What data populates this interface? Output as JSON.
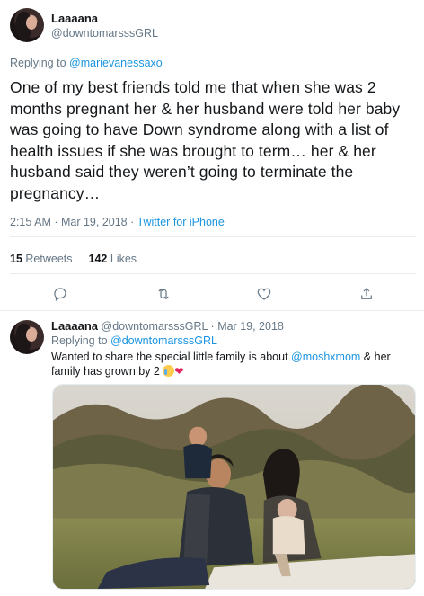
{
  "main_tweet": {
    "author_name": "Laaaana",
    "author_handle": "@downtomarsssGRL",
    "replying_prefix": "Replying to",
    "replying_to": "@marievanessaxo",
    "text": "One of my best friends told me that when she was 2 months pregnant her & her husband were told her baby was going to have Down syndrome along with a list of health issues if she was brought to term… her & her husband said they weren’t going to terminate the pregnancy…",
    "timestamp": "2:15 AM · Mar 19, 2018",
    "separator": " · ",
    "source": "Twitter for iPhone",
    "retweets_count": "15",
    "retweets_label": "Retweets",
    "likes_count": "142",
    "likes_label": "Likes"
  },
  "reply_tweet": {
    "author_name": "Laaaana",
    "author_handle": "@downtomarsssGRL",
    "date": "Mar 19, 2018",
    "dot": "·",
    "replying_prefix": "Replying to",
    "replying_to": "@downtomarsssGRL",
    "text_before": "Wanted to share the special little family is about ",
    "mention": "@moshxmom",
    "text_after": " & her family has grown by 2 "
  },
  "icons": {
    "reply": "reply-icon",
    "retweet": "retweet-icon",
    "like": "heart-icon",
    "share": "share-icon"
  },
  "colors": {
    "link": "#1b95e0",
    "secondary_text": "#657786",
    "divider": "#e6ecf0"
  }
}
